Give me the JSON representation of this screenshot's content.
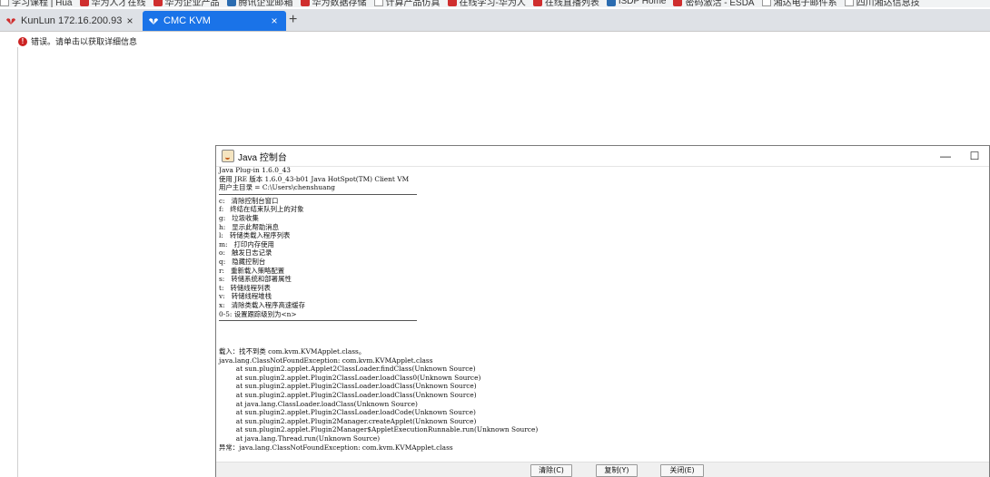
{
  "bookmarks": [
    {
      "label": "学习课程 | Hua",
      "icon": "page-icon"
    },
    {
      "label": "华为人才在线",
      "icon": "huawei-icon"
    },
    {
      "label": "华为企业产品",
      "icon": "huawei-icon"
    },
    {
      "label": "腾讯企业邮箱",
      "icon": "mail-icon"
    },
    {
      "label": "华为数据存储",
      "icon": "huawei-icon"
    },
    {
      "label": "计算产品仿真",
      "icon": "page-icon"
    },
    {
      "label": "在线学习-华为人",
      "icon": "huawei-icon"
    },
    {
      "label": "在线直播列表",
      "icon": "huawei-icon"
    },
    {
      "label": "ISDP Home",
      "icon": "isdp-icon"
    },
    {
      "label": "密码激活 - ESDA",
      "icon": "huawei-icon"
    },
    {
      "label": "湘达电子邮件系",
      "icon": "page-icon"
    },
    {
      "label": "四川湘达信息技",
      "icon": "page-icon"
    }
  ],
  "tabs": [
    {
      "label": "KunLun 172.16.200.93",
      "close": "×",
      "active": false
    },
    {
      "label": "CMC KVM",
      "close": "×",
      "active": true
    }
  ],
  "new_tab": "+",
  "page": {
    "error_icon": "!",
    "error_text": "错误。请单击以获取详细信息"
  },
  "java_console": {
    "title": "Java 控制台",
    "minimize": "—",
    "maximize": "☐",
    "header_lines": [
      "Java Plug-in 1.6.0_43",
      "使用 JRE 版本 1.6.0_43-b01 Java HotSpot(TM) Client VM",
      "用户主目录 = C:\\Users\\chenshuang"
    ],
    "help_lines": [
      "c:   清除控制台窗口",
      "f:   终结在结束队列上的对象",
      "g:   垃圾收集",
      "h:   显示此帮助消息",
      "l:   转储类载入程序列表",
      "m:   打印内存使用",
      "o:   触发日志记录",
      "q:   隐藏控制台",
      "r:   重新载入策略配置",
      "s:   转储系统和部署属性",
      "t:   转储线程列表",
      "v:   转储线程堆栈",
      "x:   清除类载入程序高速缓存",
      "0-5: 设置跟踪级别为<n>"
    ],
    "error_lines": [
      "载入：找不到类 com.kvm.KVMApplet.class。",
      "java.lang.ClassNotFoundException: com.kvm.KVMApplet.class",
      "        at sun.plugin2.applet.Applet2ClassLoader.findClass(Unknown Source)",
      "        at sun.plugin2.applet.Plugin2ClassLoader.loadClass0(Unknown Source)",
      "        at sun.plugin2.applet.Plugin2ClassLoader.loadClass(Unknown Source)",
      "        at sun.plugin2.applet.Plugin2ClassLoader.loadClass(Unknown Source)",
      "        at java.lang.ClassLoader.loadClass(Unknown Source)",
      "        at sun.plugin2.applet.Plugin2ClassLoader.loadCode(Unknown Source)",
      "        at sun.plugin2.applet.Plugin2Manager.createApplet(Unknown Source)",
      "        at sun.plugin2.applet.Plugin2Manager$AppletExecutionRunnable.run(Unknown Source)",
      "        at java.lang.Thread.run(Unknown Source)",
      "异常：java.lang.ClassNotFoundException: com.kvm.KVMApplet.class"
    ],
    "buttons": {
      "clear": "清除(C)",
      "copy": "复制(Y)",
      "close": "关闭(E)"
    }
  },
  "colors": {
    "active_tab": "#1a73e8",
    "huawei_red": "#cf2e2e",
    "error_red": "#cc2222"
  }
}
